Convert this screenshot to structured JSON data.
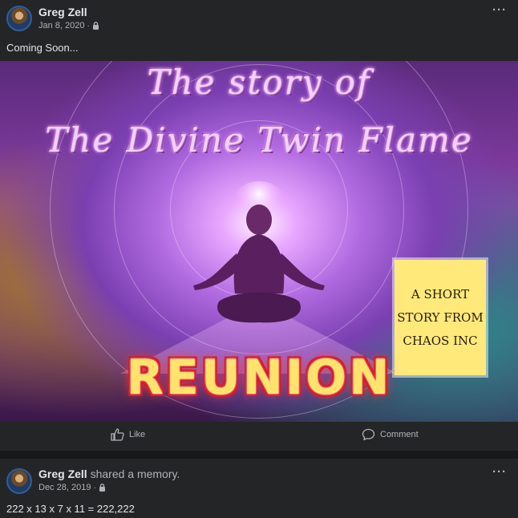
{
  "post1": {
    "author": "Greg Zell",
    "date": "Jan 8, 2020",
    "privacy_icon": "lock-icon",
    "more_label": "···",
    "text": "Coming Soon...",
    "image": {
      "title_line1": "The story of",
      "title_line2": "The Divine Twin Flame",
      "note_lines": [
        "A SHORT",
        "STORY FROM",
        "CHAOS INC"
      ],
      "banner": "REUNION"
    },
    "actions": {
      "like": "Like",
      "comment": "Comment"
    }
  },
  "post2": {
    "author": "Greg Zell",
    "suffix": "shared a memory.",
    "date": "Dec 28, 2019",
    "privacy_icon": "lock-icon",
    "more_label": "···",
    "text": "222 x 13 x 7 x 11 = 222,222"
  },
  "colors": {
    "background": "#18191a",
    "card": "#242526",
    "text": "#e4e6eb",
    "muted": "#b0b3b8"
  }
}
